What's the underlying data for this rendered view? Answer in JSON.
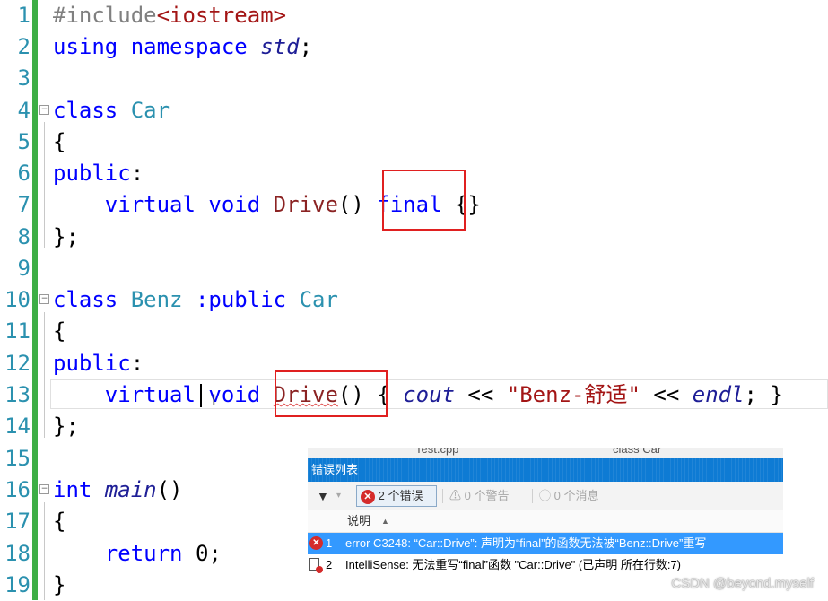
{
  "editor": {
    "line_numbers": [
      "1",
      "2",
      "3",
      "4",
      "5",
      "6",
      "7",
      "8",
      "9",
      "10",
      "11",
      "12",
      "13",
      "14",
      "15",
      "16",
      "17",
      "18",
      "19"
    ],
    "lines": {
      "l1a": "#include",
      "l1b": "<iostream>",
      "l2a": "using",
      "l2b": "namespace",
      "l2c": "std",
      "l2d": ";",
      "l4a": "class",
      "l4b": "Car",
      "l5": "{",
      "l6a": "public",
      "l6b": ":",
      "l7a": "virtual",
      "l7b": "void",
      "l7c": "Drive",
      "l7d": "()",
      "l7e": "final",
      "l7f": "{}",
      "l8": "};",
      "l10a": "class",
      "l10b": "Benz",
      "l10c": ":public",
      "l10d": "Car",
      "l11": "{",
      "l12a": "public",
      "l12b": ":",
      "l13a": "virtual",
      "l13b": "void",
      "l13c": "Drive",
      "l13d": "()",
      "l13e": "{",
      "l13f": "cout",
      "l13g": "<<",
      "l13h": "\"Benz-舒适\"",
      "l13i": "<<",
      "l13j": "endl",
      "l13k": ";",
      "l13l": "}",
      "l14": "};",
      "l16a": "int",
      "l16b": "main",
      "l16c": "()",
      "l17": "{",
      "l18a": "return",
      "l18b": "0",
      "l18c": ";",
      "l19": "}"
    }
  },
  "error_list": {
    "ghost_tab": "Test.cpp",
    "ghost_text": "class Car",
    "title": "错误列表",
    "filter_arrow": "▾",
    "errors_label": "2 个错误",
    "warnings_label": "0 个警告",
    "messages_label": "0 个消息",
    "column_description": "说明",
    "sort_indicator": "▲",
    "rows": [
      {
        "num": "1",
        "text": "error C3248: “Car::Drive”: 声明为“final”的函数无法被“Benz::Drive”重写"
      },
      {
        "num": "2",
        "text": "IntelliSense: 无法重写“final”函数 \"Car::Drive\" (已声明 所在行数:7)"
      }
    ]
  },
  "watermark": "CSDN @beyond.myself",
  "colors": {
    "keyword": "#0000ff",
    "type": "#2b91af",
    "highlight_box": "#e02020",
    "selection": "#3399ff",
    "title_bar": "#0e7bd4",
    "green_bar": "#3dae45"
  }
}
